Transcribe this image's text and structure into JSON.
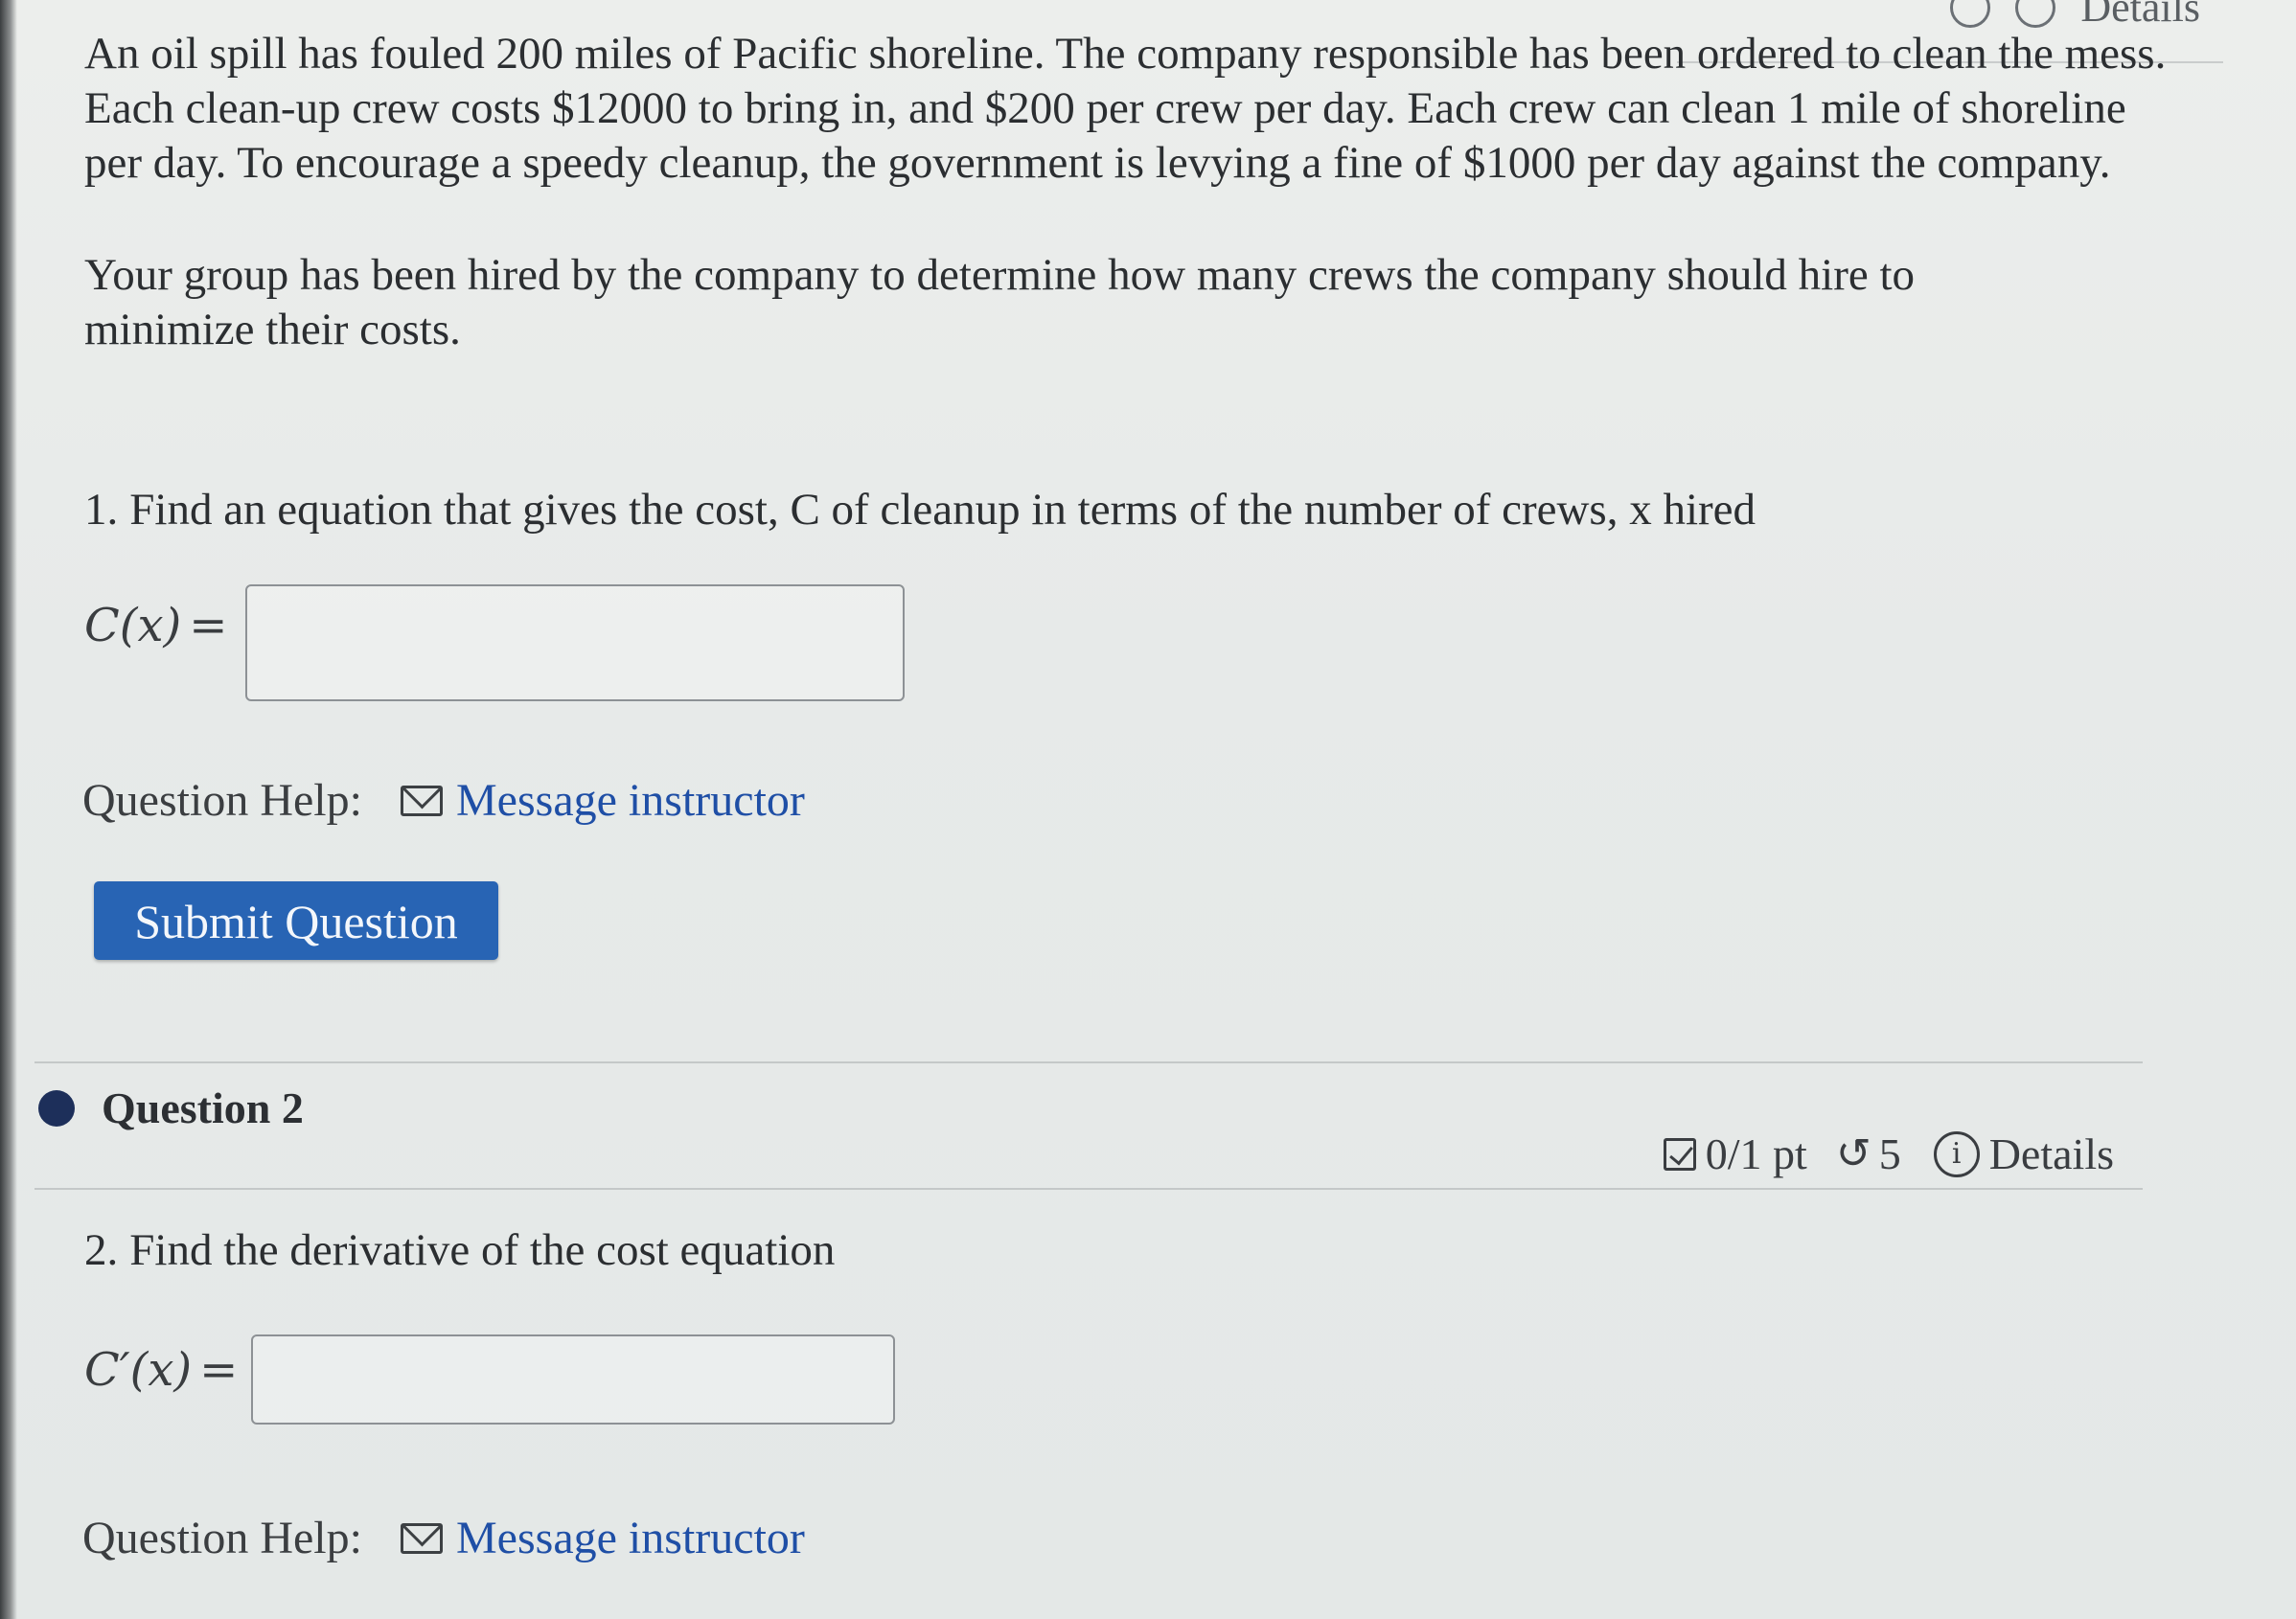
{
  "header": {
    "details_label": "Details"
  },
  "question1": {
    "problem_paragraph_1": "An oil spill has fouled 200 miles of Pacific shoreline. The company responsible has been ordered to clean the mess. Each clean-up crew costs $12000 to bring in, and $200 per crew per day. Each crew can clean 1 mile of shoreline per day. To encourage a speedy cleanup, the government is levying a fine of $1000 per day against the company.",
    "problem_paragraph_2": "Your group has been hired by the company to determine how many crews the company should hire to minimize their costs.",
    "prompt_number": "1.",
    "prompt_text": "Find an equation that gives the cost, C of cleanup in terms of the number of crews, x hired",
    "answer_label": "C(x)",
    "answer_value": "",
    "help_label": "Question Help:",
    "message_link": "Message instructor",
    "submit_label": "Submit Question"
  },
  "question2": {
    "title": "Question 2",
    "score": "0/1 pt",
    "retry_icon": "↺",
    "retries": "5",
    "info_icon": "i",
    "details_label": "Details",
    "prompt_number": "2.",
    "prompt_text": "Find the derivative of the cost equation",
    "answer_label": "C′(x)",
    "answer_value": "",
    "help_label": "Question Help:",
    "message_link": "Message instructor"
  },
  "colors": {
    "accent": "#2864b4",
    "link": "#1f4fa6",
    "status_dot": "#1d2f5a"
  }
}
